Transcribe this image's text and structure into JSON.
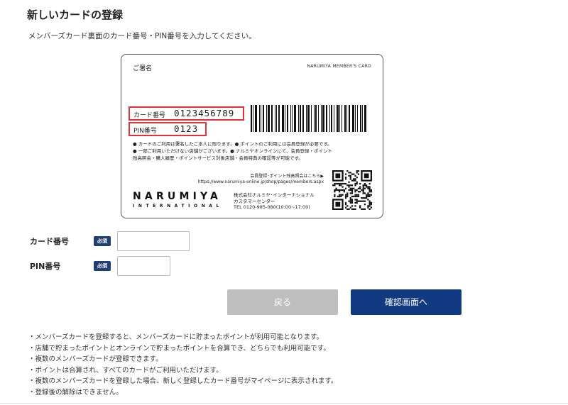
{
  "page": {
    "title": "新しいカードの登録",
    "instruction": "メンバーズカード裏面のカード番号・PIN番号を入力してください。"
  },
  "card": {
    "signature_label": "ご署名",
    "brand_header": "NARUMIYA MEMBER'S CARD",
    "card_number_label": "カード番号",
    "card_number_value": "0123456789",
    "pin_label": "PIN番号",
    "pin_value": "0123",
    "notes": [
      "● カードのご利用は署名したご本人に限ります。● ポイントのご利用には会員登録が必要です。",
      "● 一部ご利用いただけない店舗がございます。● ナルミヤオンラインにて、会員登録・ポイント",
      "残高照会・購入履歴・ポイントサービス対象店舗・会員特典の確認等が可能です。"
    ],
    "register_text": "会員登録･ポイント残高照会はこちら▶",
    "register_url": "https://www.narumiya-online.jp/shop/pages/members.aspx",
    "logo_main": "NARUMIYA",
    "logo_sub": "INTERNATIONAL",
    "company_name": "株式会社ナルミヤ･インターナショナル",
    "support_center": "カスタマーセンター",
    "tel": "TEL 0120-985-080(10:00~17:00)"
  },
  "form": {
    "card_number_label": "カード番号",
    "pin_label": "PIN番号",
    "required_badge": "必須",
    "card_number_value": "",
    "pin_value": ""
  },
  "buttons": {
    "back": "戻る",
    "confirm": "確認画面へ"
  },
  "colors": {
    "accent": "#123a82",
    "badge": "#1f3f73",
    "highlight_red": "#e0323a",
    "disabled": "#bfbfbf"
  },
  "notes": [
    "・メンバーズカードを登録すると、メンバーズカードに貯まったポイントが利用可能となります。",
    "・店舗で貯まったポイントとオンラインで貯まったポイントを合算でき、どちらでも利用可能です。",
    "・複数のメンバーズカードが登録できます。",
    "・ポイントは合算され、すべてのカードがご利用いただけます。",
    "・複数のメンバーズカードを登録した場合、新しく登録したカード番号がマイページに表示されます。",
    "・登録後の解除はできません。"
  ]
}
